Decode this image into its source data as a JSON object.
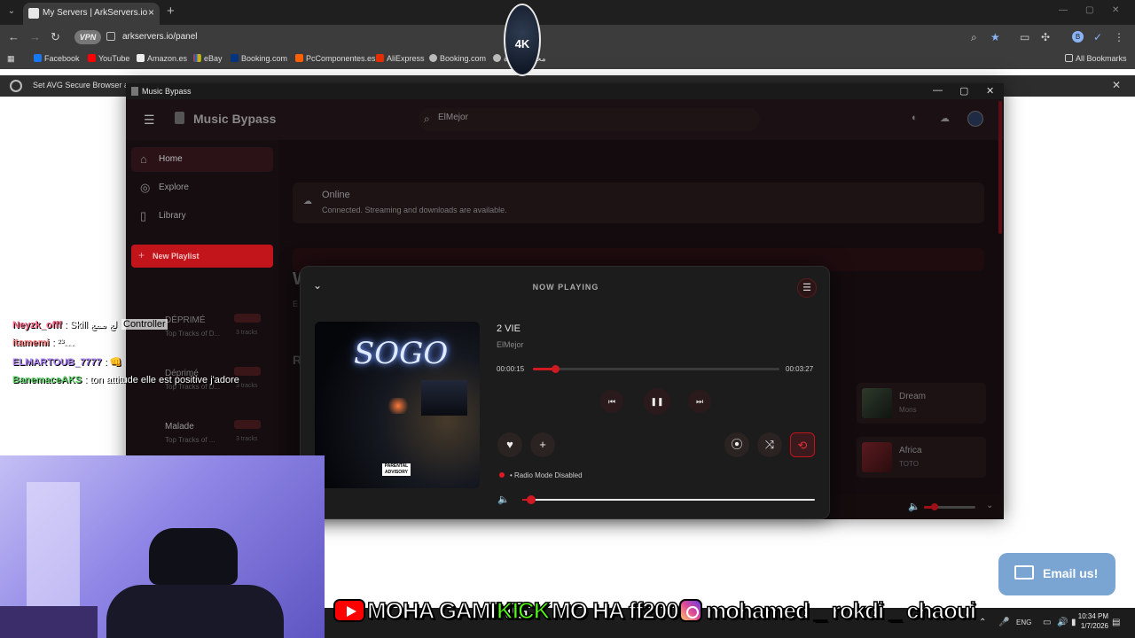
{
  "browser": {
    "tab_title": "My Servers | ArkServers.io",
    "url": "arkservers.io/panel",
    "vpn_label": "VPN",
    "bookmarks": [
      "Facebook",
      "YouTube",
      "Amazon.es",
      "eBay",
      "Booking.com",
      "PcComponentes.es",
      "AliExpress",
      "Booking.com",
      "محتوى القناة"
    ],
    "all_bookmarks": "All Bookmarks",
    "infobar_message": "Set AVG Secure Browser as",
    "logo_text": "4K"
  },
  "app": {
    "window_title": "Music Bypass",
    "brand": "Music Bypass",
    "search_value": "ElMejor",
    "nav": [
      {
        "label": "Home",
        "icon": "home-icon"
      },
      {
        "label": "Explore",
        "icon": "compass-icon"
      },
      {
        "label": "Library",
        "icon": "bookmark-icon"
      }
    ],
    "new_playlist": "New Playlist",
    "playlists": [
      {
        "name": "DÉPRIMÉ",
        "subtitle": "Top Tracks of D...",
        "count": "3 tracks"
      },
      {
        "name": "Déprimé",
        "subtitle": "Top Tracks of D...",
        "count": "3 tracks"
      },
      {
        "name": "Malade",
        "subtitle": "Top Tracks of ...",
        "count": "3 tracks"
      }
    ],
    "status": {
      "title": "Online",
      "detail": "Connected. Streaming and downloads are available."
    },
    "partial_heading": "W",
    "partial_sub": "E",
    "partial_section": "R",
    "side_songs": [
      {
        "name": "Dream",
        "artist": "Mons"
      },
      {
        "name": "Africa",
        "artist": "TOTO"
      }
    ],
    "mini_volume": 0.2
  },
  "now_playing": {
    "header": "NOW PLAYING",
    "song": "2 VIE",
    "artist": "ElMejor",
    "elapsed": "00:00:15",
    "total": "00:03:27",
    "progress": 0.09,
    "radio_status": "• Radio Mode Disabled",
    "volume": 0.03,
    "album_text": "SOGO",
    "advisory": "PARENTAL ADVISORY"
  },
  "overlay": {
    "chat": [
      {
        "user": "Neyzk_offf",
        "message": ": Skill لع ممع",
        "color": "#ff6b8b"
      },
      {
        "user": "itamemi",
        "message": ": ۦۦۦ²³",
        "color": "#ff8080"
      },
      {
        "user": "ELMARTOUB_7777",
        "message": ": 👊",
        "color": "#b48cff"
      },
      {
        "user": "BanemaceAKS",
        "message": ": ton attitude elle est positive j'adore",
        "color": "#5fd46a"
      }
    ],
    "chat_tag": "Controller",
    "email_button": "Email us!",
    "social_youtube": "MOHA GAMING",
    "social_kick_label": "KICK",
    "social_kick": "MO HA ff2000",
    "social_instagram": "mohamed _ rokdi _ chaoui"
  },
  "taskbar": {
    "language": "ENG",
    "time": "10:34 PM",
    "date": "1/7/2026"
  },
  "colors": {
    "accent": "#c1141b",
    "app_bg": "#130b0d",
    "panel_bg": "#1c1c1c",
    "email_bg": "#7aa4d2",
    "kick_green": "#53fc18"
  }
}
